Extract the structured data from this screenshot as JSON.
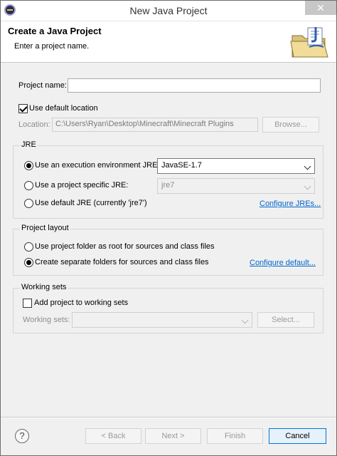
{
  "window": {
    "title": "New Java Project",
    "close_glyph": "✕"
  },
  "banner": {
    "title": "Create a Java Project",
    "message": "Enter a project name.",
    "graphic": "java-project-folder-icon"
  },
  "project": {
    "name_label": "Project name:",
    "name_value": "",
    "use_default_location_label": "Use default location",
    "use_default_location": true,
    "location_label": "Location:",
    "location_value": "C:\\Users\\Ryan\\Desktop\\Minecraft\\Minecraft Plugins",
    "browse_label": "Browse..."
  },
  "jre": {
    "title": "JRE",
    "exec_env_label": "Use an execution environment JRE:",
    "exec_env_value": "JavaSE-1.7",
    "project_specific_label": "Use a project specific JRE:",
    "project_specific_value": "jre7",
    "default_label": "Use default JRE (currently 'jre7')",
    "configure_link": "Configure JREs...",
    "selected": "exec_env"
  },
  "layout": {
    "title": "Project layout",
    "root_label": "Use project folder as root for sources and class files",
    "separate_label": "Create separate folders for sources and class files",
    "configure_link": "Configure default...",
    "selected": "separate"
  },
  "working_sets": {
    "title": "Working sets",
    "add_label": "Add project to working sets",
    "add_checked": false,
    "sets_label": "Working sets:",
    "select_label": "Select..."
  },
  "footer": {
    "help_glyph": "?",
    "back_label": "< Back",
    "next_label": "Next >",
    "finish_label": "Finish",
    "cancel_label": "Cancel"
  },
  "colors": {
    "link": "#0066cc",
    "dialog_bg": "#f0f0f0",
    "close_button": "#c7c7c7"
  }
}
